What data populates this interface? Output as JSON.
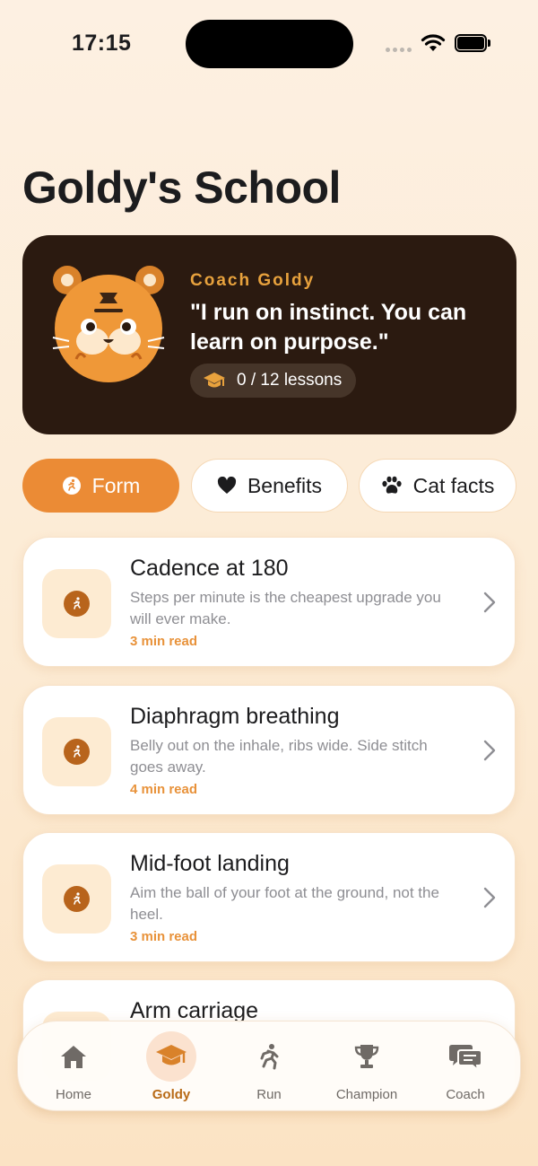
{
  "status_bar": {
    "time": "17:15"
  },
  "page": {
    "title": "Goldy's School"
  },
  "hero": {
    "label": "Coach Goldy",
    "quote": "\"I run on instinct. You can learn on purpose.\"",
    "progress_text": "0 / 12 lessons",
    "progress": {
      "completed": 0,
      "total": 12
    }
  },
  "tabs": [
    {
      "label": "Form",
      "icon": "running-icon",
      "selected": true
    },
    {
      "label": "Benefits",
      "icon": "heart-icon",
      "selected": false
    },
    {
      "label": "Cat facts",
      "icon": "paw-icon",
      "selected": false
    }
  ],
  "lessons": [
    {
      "title": "Cadence at 180",
      "description": "Steps per minute is the cheapest upgrade you will ever make.",
      "read_time": "3 min read"
    },
    {
      "title": "Diaphragm breathing",
      "description": "Belly out on the inhale, ribs wide. Side stitch goes away.",
      "read_time": "4 min read"
    },
    {
      "title": "Mid-foot landing",
      "description": "Aim the ball of your foot at the ground, not the heel.",
      "read_time": "3 min read"
    },
    {
      "title": "Arm carriage"
    }
  ],
  "tab_bar": {
    "items": [
      {
        "label": "Home",
        "icon": "house-icon",
        "selected": false
      },
      {
        "label": "Goldy",
        "icon": "graduation-cap-icon",
        "selected": true
      },
      {
        "label": "Run",
        "icon": "runner-icon",
        "selected": false
      },
      {
        "label": "Champion",
        "icon": "trophy-icon",
        "selected": false
      },
      {
        "label": "Coach",
        "icon": "chat-bubbles-icon",
        "selected": false
      }
    ]
  },
  "colors": {
    "accent": "#eb8b35",
    "hero_bg": "#2b1a10",
    "hero_label": "#e8a23d",
    "read_time": "#e8923a",
    "tab_selected": "#b86a16"
  }
}
